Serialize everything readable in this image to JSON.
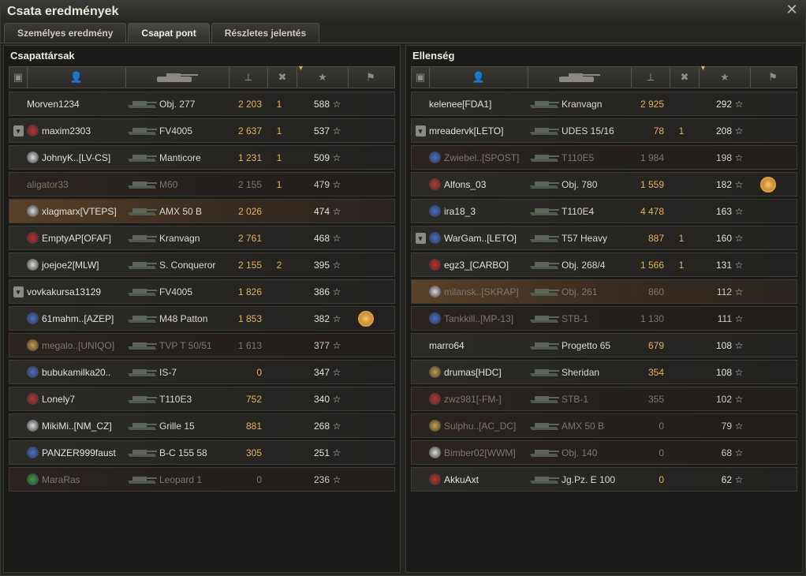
{
  "window": {
    "title": "Csata eredmények"
  },
  "tabs": [
    {
      "label": "Személyes eredmény",
      "active": false
    },
    {
      "label": "Csapat pont",
      "active": true
    },
    {
      "label": "Részletes jelentés",
      "active": false
    }
  ],
  "icons": {
    "close": "close-icon",
    "platoon": "platoon-icon",
    "player": "player-icon",
    "tank": "tank-icon",
    "damage": "damage-icon",
    "kills": "kills-icon",
    "score": "star-icon",
    "medal": "medal-icon"
  },
  "colors": {
    "damage": "#e7b25a",
    "dead_text": "#7c776c",
    "highlight": "#5a4128"
  },
  "teams": [
    {
      "title": "Csapattársak",
      "rows": [
        {
          "name": "Morven1234",
          "tank": "Obj. 277",
          "damage": "2 203",
          "kills": "1",
          "score": "588",
          "platoon": false,
          "dead": false,
          "hl": false,
          "badge": "",
          "medal": false
        },
        {
          "name": "maxim2303",
          "tank": "FV4005",
          "damage": "2 637",
          "kills": "1",
          "score": "537",
          "platoon": true,
          "dead": false,
          "hl": false,
          "badge": "#c13030",
          "medal": false
        },
        {
          "name": "JohnyK..[LV-CS]",
          "tank": "Manticore",
          "damage": "1 231",
          "kills": "1",
          "score": "509",
          "platoon": false,
          "dead": false,
          "hl": false,
          "badge": "#dddddd",
          "medal": false
        },
        {
          "name": "aligator33",
          "tank": "M60",
          "damage": "2 155",
          "kills": "1",
          "score": "479",
          "platoon": false,
          "dead": true,
          "hl": false,
          "badge": "",
          "medal": false
        },
        {
          "name": "xlagmarx[VTEPS]",
          "tank": "AMX 50 B",
          "damage": "2 026",
          "kills": "",
          "score": "474",
          "platoon": false,
          "dead": false,
          "hl": true,
          "badge": "#dddddd",
          "medal": false
        },
        {
          "name": "EmptyAP[OFAF]",
          "tank": "Kranvagn",
          "damage": "2 761",
          "kills": "",
          "score": "468",
          "platoon": false,
          "dead": false,
          "hl": false,
          "badge": "#c02b2b",
          "medal": false
        },
        {
          "name": "joejoe2[MLW]",
          "tank": "S. Conqueror",
          "damage": "2 155",
          "kills": "2",
          "score": "395",
          "platoon": false,
          "dead": false,
          "hl": false,
          "badge": "#dddddd",
          "medal": false
        },
        {
          "name": "vovkakursa13129",
          "tank": "FV4005",
          "damage": "1 826",
          "kills": "",
          "score": "386",
          "platoon": true,
          "dead": false,
          "hl": false,
          "badge": "",
          "medal": false
        },
        {
          "name": "61mahm..[AZEP]",
          "tank": "M48 Patton",
          "damage": "1 853",
          "kills": "",
          "score": "382",
          "platoon": false,
          "dead": false,
          "hl": false,
          "badge": "#4a6fd1",
          "medal": true
        },
        {
          "name": "megalo..[UNIQO]",
          "tank": "TVP T 50/51",
          "damage": "1 613",
          "kills": "",
          "score": "377",
          "platoon": false,
          "dead": true,
          "hl": false,
          "badge": "#c9a24a",
          "medal": false
        },
        {
          "name": "bubukamilka20..",
          "tank": "IS-7",
          "damage": "0",
          "kills": "",
          "score": "347",
          "platoon": false,
          "dead": false,
          "hl": false,
          "badge": "#4a6fd1",
          "medal": false
        },
        {
          "name": "Lonely7",
          "tank": "T110E3",
          "damage": "752",
          "kills": "",
          "score": "340",
          "platoon": false,
          "dead": false,
          "hl": false,
          "badge": "#c13030",
          "medal": false
        },
        {
          "name": "MikiMi..[NM_CZ]",
          "tank": "Grille 15",
          "damage": "881",
          "kills": "",
          "score": "268",
          "platoon": false,
          "dead": false,
          "hl": false,
          "badge": "#dddddd",
          "medal": false
        },
        {
          "name": "PANZER999faust",
          "tank": "B-C 155 58",
          "damage": "305",
          "kills": "",
          "score": "251",
          "platoon": false,
          "dead": false,
          "hl": false,
          "badge": "#4a6fd1",
          "medal": false
        },
        {
          "name": "MaraRas",
          "tank": "Leopard 1",
          "damage": "0",
          "kills": "",
          "score": "236",
          "platoon": false,
          "dead": true,
          "hl": false,
          "badge": "#3aa04a",
          "medal": false
        }
      ]
    },
    {
      "title": "Ellenség",
      "rows": [
        {
          "name": "kelenee[FDA1]",
          "tank": "Kranvagn",
          "damage": "2 925",
          "kills": "",
          "score": "292",
          "platoon": false,
          "dead": false,
          "hl": false,
          "badge": "",
          "medal": false
        },
        {
          "name": "mreadervk[LETO]",
          "tank": "UDES 15/16",
          "damage": "78",
          "kills": "1",
          "score": "208",
          "platoon": true,
          "dead": false,
          "hl": false,
          "badge": "",
          "medal": false
        },
        {
          "name": "Zwiebel..[SPOST]",
          "tank": "T110E5",
          "damage": "1 984",
          "kills": "",
          "score": "198",
          "platoon": false,
          "dead": true,
          "hl": false,
          "badge": "#4a6fd1",
          "medal": false
        },
        {
          "name": "Alfons_03",
          "tank": "Obj. 780",
          "damage": "1 559",
          "kills": "",
          "score": "182",
          "platoon": false,
          "dead": false,
          "hl": false,
          "badge": "#c0392b",
          "medal": true
        },
        {
          "name": "ira18_3",
          "tank": "T110E4",
          "damage": "4 478",
          "kills": "",
          "score": "163",
          "platoon": false,
          "dead": false,
          "hl": false,
          "badge": "#4a6fd1",
          "medal": false
        },
        {
          "name": "WarGam..[LETO]",
          "tank": "T57 Heavy",
          "damage": "887",
          "kills": "1",
          "score": "160",
          "platoon": true,
          "dead": false,
          "hl": false,
          "badge": "#4a6fd1",
          "medal": false
        },
        {
          "name": "egz3_[CARBO]",
          "tank": "Obj. 268/4",
          "damage": "1 566",
          "kills": "1",
          "score": "131",
          "platoon": false,
          "dead": false,
          "hl": false,
          "badge": "#c02b2b",
          "medal": false
        },
        {
          "name": "milansk..[SKRAP]",
          "tank": "Obj. 261",
          "damage": "860",
          "kills": "",
          "score": "112",
          "platoon": false,
          "dead": true,
          "hl": true,
          "badge": "#dddddd",
          "medal": false
        },
        {
          "name": "Tankkill..[MP-13]",
          "tank": "STB-1",
          "damage": "1 130",
          "kills": "",
          "score": "111",
          "platoon": false,
          "dead": true,
          "hl": false,
          "badge": "#4a6fd1",
          "medal": false
        },
        {
          "name": "marro64",
          "tank": "Progetto 65",
          "damage": "679",
          "kills": "",
          "score": "108",
          "platoon": false,
          "dead": false,
          "hl": false,
          "badge": "",
          "medal": false
        },
        {
          "name": "drumas[HDC]",
          "tank": "Sheridan",
          "damage": "354",
          "kills": "",
          "score": "108",
          "platoon": false,
          "dead": false,
          "hl": false,
          "badge": "#c9a24a",
          "medal": false
        },
        {
          "name": "zwz981[-FM-]",
          "tank": "STB-1",
          "damage": "355",
          "kills": "",
          "score": "102",
          "platoon": false,
          "dead": true,
          "hl": false,
          "badge": "#c13030",
          "medal": false
        },
        {
          "name": "Sulphu..[AC_DC]",
          "tank": "AMX 50 B",
          "damage": "0",
          "kills": "",
          "score": "79",
          "platoon": false,
          "dead": true,
          "hl": false,
          "badge": "#c9a24a",
          "medal": false
        },
        {
          "name": "Bimber02[WWM]",
          "tank": "Obj. 140",
          "damage": "0",
          "kills": "",
          "score": "68",
          "platoon": false,
          "dead": true,
          "hl": false,
          "badge": "#dddddd",
          "medal": false
        },
        {
          "name": "AkkuAxt",
          "tank": "Jg.Pz. E 100",
          "damage": "0",
          "kills": "",
          "score": "62",
          "platoon": false,
          "dead": false,
          "hl": false,
          "badge": "#c13030",
          "medal": false
        }
      ]
    }
  ]
}
